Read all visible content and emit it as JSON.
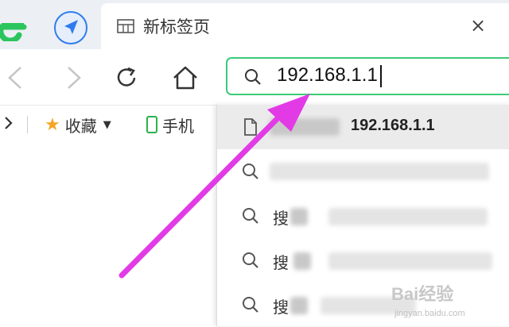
{
  "tab": {
    "title": "新标签页",
    "close_glyph": "×"
  },
  "icons": {
    "browser_logo": "browser-logo-icon",
    "navigate": "navigate-arrow-icon",
    "back": "back-arrow-icon",
    "forward": "forward-arrow-icon",
    "reload": "reload-icon",
    "home": "home-icon",
    "search": "search-icon",
    "document": "document-icon"
  },
  "bookmarks": [
    {
      "label": "收藏",
      "icon": "star-icon"
    },
    {
      "label": "手机",
      "icon": "phone-icon"
    }
  ],
  "omnibox": {
    "value": "192.168.1.1"
  },
  "suggestions": [
    {
      "type": "url",
      "icon": "document-icon",
      "prefix": "",
      "text": "192.168.1.1"
    },
    {
      "type": "search",
      "icon": "search-icon",
      "prefix": "",
      "text": ""
    },
    {
      "type": "search",
      "icon": "search-icon",
      "prefix": "搜",
      "text": ""
    },
    {
      "type": "search",
      "icon": "search-icon",
      "prefix": "搜",
      "text": ""
    },
    {
      "type": "search",
      "icon": "search-icon",
      "prefix": "搜",
      "text": ""
    }
  ],
  "watermark": {
    "brand": "Bai经验",
    "sub": "jingyan.baidu.com"
  },
  "colors": {
    "accent_green": "#3ccb78",
    "annotation_magenta": "#e23be6",
    "nav_blue": "#2f7cf0"
  }
}
